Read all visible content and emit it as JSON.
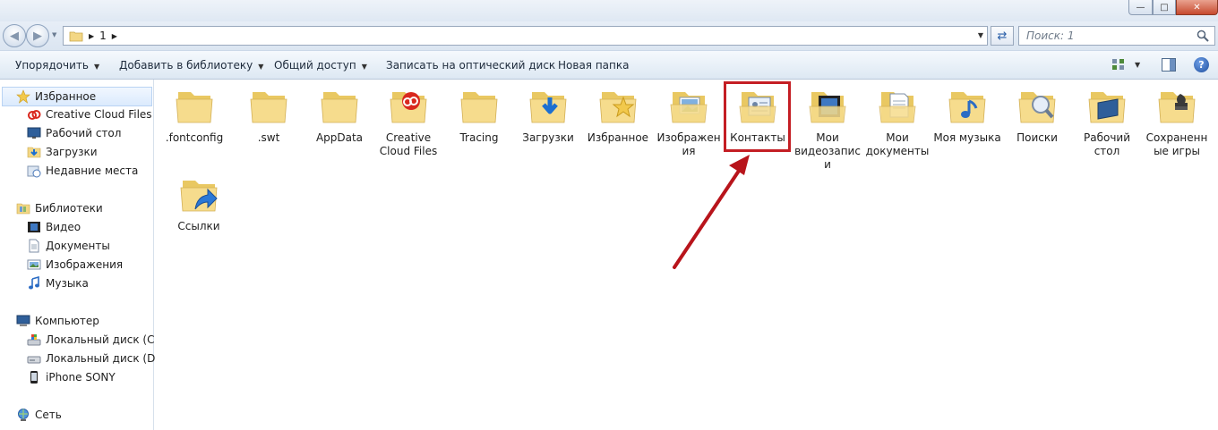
{
  "window": {
    "minimize_glyph": "—",
    "maximize_glyph": "□",
    "close_glyph": "✕"
  },
  "address": {
    "crumb": "1",
    "search_placeholder": "Поиск: 1"
  },
  "toolbar": {
    "organize": "Упорядочить",
    "add_to_library": "Добавить в библиотеку",
    "share": "Общий доступ",
    "burn": "Записать на оптический диск",
    "new_folder": "Новая папка",
    "help": "?"
  },
  "sidebar": {
    "favorites": "Избранное",
    "fav_items": [
      "Creative Cloud Files",
      "Рабочий стол",
      "Загрузки",
      "Недавние места"
    ],
    "libraries": "Библиотеки",
    "lib_items": [
      "Видео",
      "Документы",
      "Изображения",
      "Музыка"
    ],
    "computer": "Компьютер",
    "comp_items": [
      "Локальный диск (C:)",
      "Локальный диск (D:)",
      "iPhone SONY"
    ],
    "network": "Сеть"
  },
  "folders": [
    {
      "label": ".fontconfig",
      "icon": "folder-icon"
    },
    {
      "label": ".swt",
      "icon": "folder-icon"
    },
    {
      "label": "AppData",
      "icon": "folder-icon"
    },
    {
      "label": "Creative Cloud Files",
      "icon": "creative-cloud-folder-icon"
    },
    {
      "label": "Tracing",
      "icon": "folder-icon"
    },
    {
      "label": "Загрузки",
      "icon": "downloads-folder-icon"
    },
    {
      "label": "Избранное",
      "icon": "favorites-folder-icon"
    },
    {
      "label": "Изображения",
      "icon": "pictures-folder-icon"
    },
    {
      "label": "Контакты",
      "icon": "contacts-folder-icon"
    },
    {
      "label": "Мои видеозаписи",
      "icon": "videos-folder-icon"
    },
    {
      "label": "Мои документы",
      "icon": "documents-folder-icon"
    },
    {
      "label": "Моя музыка",
      "icon": "music-folder-icon"
    },
    {
      "label": "Поиски",
      "icon": "searches-folder-icon"
    },
    {
      "label": "Рабочий стол",
      "icon": "desktop-folder-icon"
    },
    {
      "label": "Сохраненные игры",
      "icon": "saved-games-folder-icon"
    },
    {
      "label": "Ссылки",
      "icon": "links-folder-icon"
    }
  ],
  "colors": {
    "highlight": "#c41e24",
    "folder": "#f3d785"
  }
}
